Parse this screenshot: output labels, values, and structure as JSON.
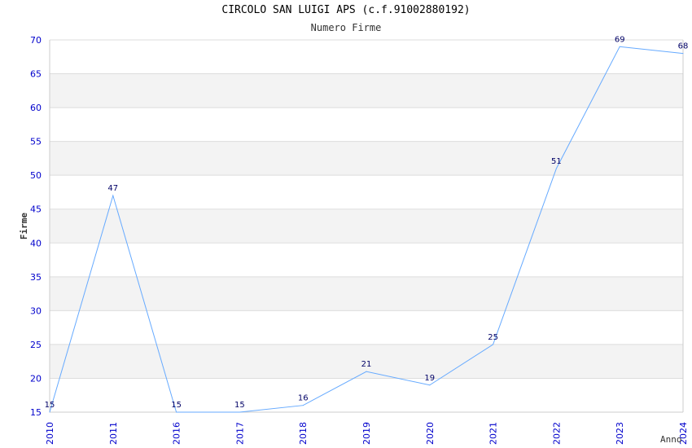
{
  "chart_data": {
    "type": "line",
    "title": "CIRCOLO SAN LUIGI APS (c.f.91002880192)",
    "subtitle": "Numero Firme",
    "xlabel": "Anno",
    "ylabel": "Firme",
    "categories": [
      "2010",
      "2011",
      "2016",
      "2017",
      "2018",
      "2019",
      "2020",
      "2021",
      "2022",
      "2023",
      "2024"
    ],
    "series": [
      {
        "values": [
          15,
          47,
          15,
          15,
          16,
          21,
          19,
          25,
          51,
          69,
          68
        ]
      }
    ],
    "data_labels": [
      "15",
      "47",
      "15",
      "15",
      "16",
      "21",
      "19",
      "25",
      "51",
      "69",
      "68"
    ],
    "ylim": [
      15,
      70
    ],
    "yticks": [
      15,
      20,
      25,
      30,
      35,
      40,
      45,
      50,
      55,
      60,
      65,
      70
    ],
    "grid": true,
    "colors": {
      "line": "#66aaff",
      "tick_labels": "#0000cc",
      "data_labels": "#000066",
      "band": "#f3f3f3"
    }
  }
}
